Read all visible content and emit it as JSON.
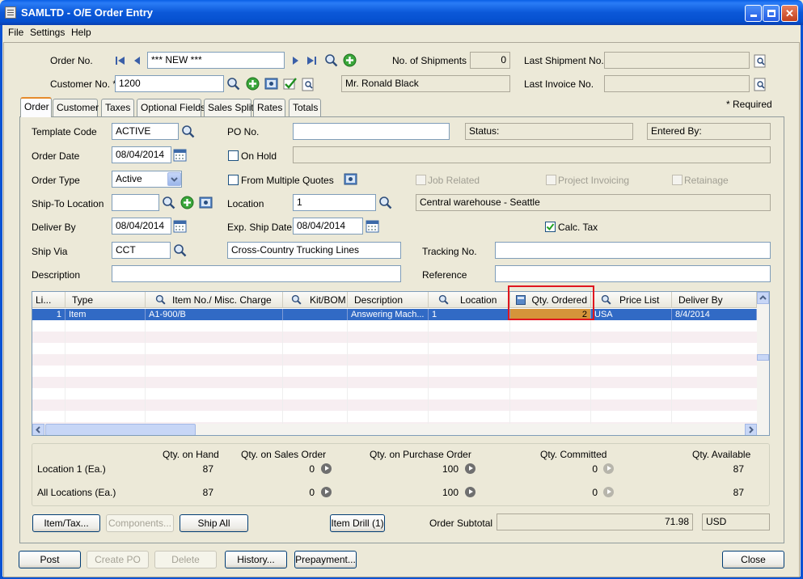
{
  "window": {
    "title": "SAMLTD - O/E Order Entry",
    "min": "_",
    "max": "□",
    "close": "✕"
  },
  "menu": [
    "File",
    "Settings",
    "Help"
  ],
  "header": {
    "order_no_label": "Order No.",
    "order_no_value": "*** NEW ***",
    "customer_no_label": "Customer No. *",
    "customer_no_value": "1200",
    "customer_name": "Mr. Ronald Black",
    "shipments_label": "No. of Shipments",
    "shipments_value": "0",
    "last_shipment_label": "Last Shipment No.",
    "last_invoice_label": "Last Invoice No.",
    "required_note": "*  Required"
  },
  "tabs": [
    "Order",
    "Customer",
    "Taxes",
    "Optional Fields",
    "Sales Split",
    "Rates",
    "Totals"
  ],
  "order": {
    "template_code_label": "Template Code",
    "template_code": "ACTIVE",
    "po_label": "PO No.",
    "status_label": "Status:",
    "entered_by_label": "Entered By:",
    "order_date_label": "Order Date",
    "order_date": "08/04/2014",
    "on_hold_label": "On Hold",
    "order_type_label": "Order Type",
    "order_type": "Active",
    "from_quotes_label": "From Multiple Quotes",
    "job_related_label": "Job Related",
    "project_invoicing_label": "Project Invoicing",
    "retainage_label": "Retainage",
    "ship_to_label": "Ship-To Location",
    "location_label": "Location",
    "location_value": "1",
    "location_desc": "Central warehouse - Seattle",
    "deliver_by_label": "Deliver By",
    "deliver_by": "08/04/2014",
    "exp_ship_label": "Exp. Ship Date",
    "exp_ship": "08/04/2014",
    "calc_tax_label": "Calc. Tax",
    "ship_via_label": "Ship Via",
    "ship_via": "CCT",
    "ship_via_desc": "Cross-Country Trucking Lines",
    "tracking_label": "Tracking No.",
    "description_label": "Description",
    "reference_label": "Reference"
  },
  "grid": {
    "headers": [
      "Li...",
      "Type",
      "Item No./ Misc. Charge",
      "Kit/BOM",
      "Description",
      "Location",
      "Qty. Ordered",
      "Price List",
      "Deliver By"
    ],
    "rows": [
      [
        "1",
        "Item",
        "A1-900/B",
        "",
        "Answering Mach...",
        "1",
        "2",
        "USA",
        "8/4/2014"
      ]
    ]
  },
  "qty": {
    "headers": [
      "Qty. on Hand",
      "Qty. on Sales Order",
      "Qty. on Purchase Order",
      "Qty. Committed",
      "Qty. Available"
    ],
    "rows": [
      {
        "label": "Location  1 (Ea.)",
        "values": [
          "87",
          "0",
          "100",
          "0",
          "87"
        ]
      },
      {
        "label": "All Locations (Ea.)",
        "values": [
          "87",
          "0",
          "100",
          "0",
          "87"
        ]
      }
    ]
  },
  "bottom": {
    "item_tax": "Item/Tax...",
    "components": "Components...",
    "ship_all": "Ship All",
    "item_drill": "Item Drill (1)",
    "subtotal_label": "Order Subtotal",
    "subtotal": "71.98",
    "currency": "USD"
  },
  "footer": {
    "post": "Post",
    "create_po": "Create PO",
    "delete": "Delete",
    "history": "History...",
    "prepayment": "Prepayment...",
    "close": "Close"
  }
}
